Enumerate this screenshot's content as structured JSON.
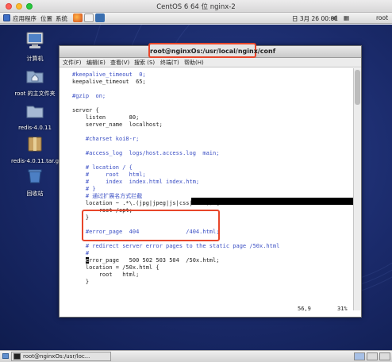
{
  "host_window": {
    "title": "CentOS 6 64 位 nginx-2"
  },
  "guest_panel": {
    "menu_applications": "应用程序",
    "menu_places": "位置",
    "menu_system": "系统",
    "clock": "日 3月 26 00:01",
    "user": "root"
  },
  "desktop": {
    "icons": [
      {
        "label": "计算机",
        "icon": "computer-icon"
      },
      {
        "label": "root 的主文件夹",
        "icon": "home-folder-icon"
      },
      {
        "label": "redis-4.0.11",
        "icon": "folder-icon"
      },
      {
        "label": "redis-4.0.11.tar.gz",
        "icon": "archive-icon"
      },
      {
        "label": "回收站",
        "icon": "trash-icon"
      }
    ]
  },
  "terminal": {
    "title": "root@nginxOs:/usr/local/nginx/conf",
    "menu": [
      "文件(F)",
      "编辑(E)",
      "查看(V)",
      "搜索 (S)",
      "终端(T)",
      "帮助(H)"
    ],
    "lines": [
      "#keepalive_timeout  0;",
      "keepalive_timeout  65;",
      "",
      "#gzip  on;",
      "",
      "server {",
      "    listen       80;",
      "    server_name  localhost;",
      "",
      "    #charset koi8-r;",
      "",
      "    #access_log  logs/host.access.log  main;",
      "",
      "    # location / {",
      "    #     root   html;",
      "    #     index  index.html index.htm;",
      "    # }",
      "    # 通过扩展名方式拦截",
      "    location ~ .*\\.(jpg|jpeg|js|css|html)$ {",
      "        root /opt;",
      "    }",
      "",
      "    #error_page  404              /404.html;",
      "",
      "    # redirect server error pages to the static page /50x.html",
      "    #",
      "    error_page   500 502 503 504  /50x.html;",
      "    location = /50x.html {",
      "        root   html;",
      "    }"
    ],
    "cursor_char": "e",
    "cursor_rest": "rror_page   500 502 503 504  /50x.html;",
    "status_position": "56,9",
    "status_percent": "31%"
  },
  "taskbar": {
    "active_task": "root@nginxOs:/usr/loc..."
  }
}
